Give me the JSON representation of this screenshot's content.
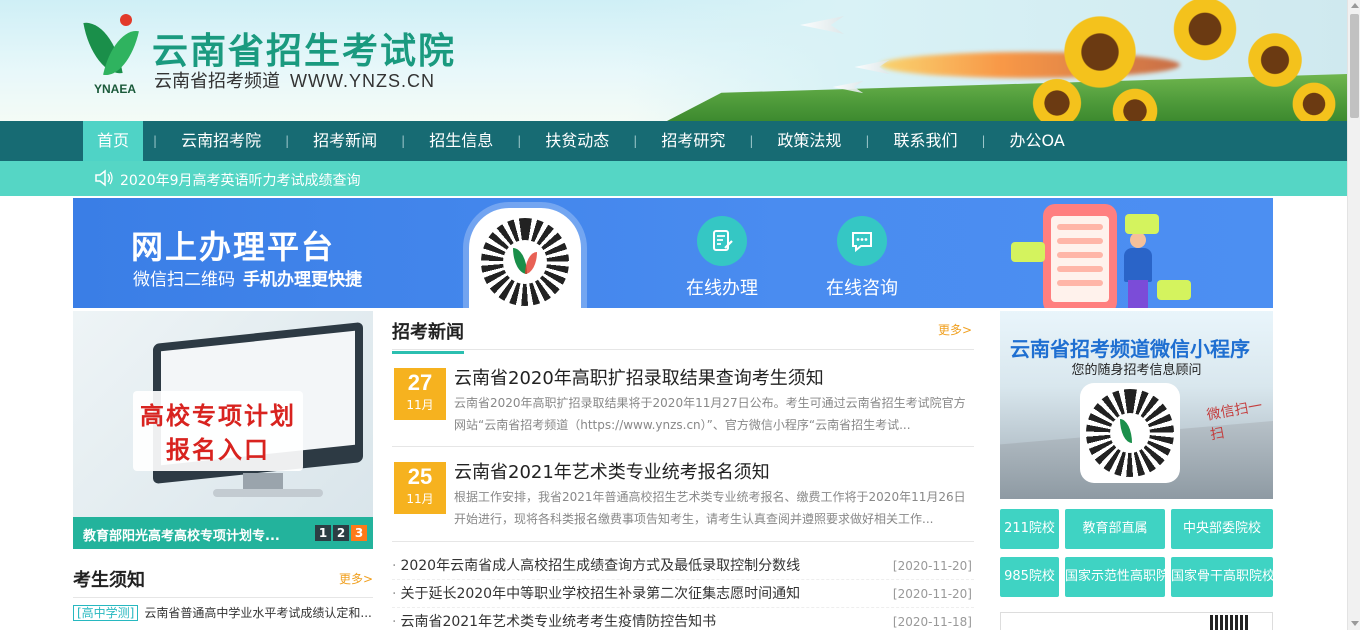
{
  "header": {
    "logo_abbr": "YNAEA",
    "title": "云南省招生考试院",
    "subtitle": "云南省招考频道",
    "url": "WWW.YNZS.CN"
  },
  "nav": {
    "items": [
      {
        "label": "首页",
        "active": true
      },
      {
        "label": "云南招考院"
      },
      {
        "label": "招考新闻"
      },
      {
        "label": "招生信息"
      },
      {
        "label": "扶贫动态"
      },
      {
        "label": "招考研究"
      },
      {
        "label": "政策法规"
      },
      {
        "label": "联系我们"
      },
      {
        "label": "办公OA"
      }
    ]
  },
  "ticker": {
    "icon": "speaker-icon",
    "text": "2020年9月高考英语听力考试成绩查询"
  },
  "platform": {
    "title": "网上办理平台",
    "subtitle_a": "微信扫二维码",
    "subtitle_b": "手机办理更快捷",
    "services": [
      {
        "label": "在线办理",
        "icon": "form-edit-icon"
      },
      {
        "label": "在线咨询",
        "icon": "chat-icon"
      }
    ]
  },
  "promo": {
    "headline_1": "高校专项计划",
    "headline_2": "报名入口",
    "caption": "教育部阳光高考高校专项计划专...",
    "pages": [
      "1",
      "2",
      "3"
    ],
    "active_page": "3"
  },
  "notice": {
    "title": "考生须知",
    "more": "更多>",
    "rows": [
      {
        "tag": "[高中学测]",
        "text": "云南省普通高中学业水平考试成绩认定和..."
      }
    ]
  },
  "news": {
    "title": "招考新闻",
    "more": "更多>",
    "featured": [
      {
        "day": "27",
        "month": "11月",
        "title": "云南省2020年高职扩招录取结果查询考生须知",
        "desc": "云南省2020年高职扩招录取结果将于2020年11月27日公布。考生可通过云南省招生考试院官方网站“云南省招考频道（https://www.ynzs.cn）”、官方微信小程序“云南省招生考试..."
      },
      {
        "day": "25",
        "month": "11月",
        "title": "云南省2021年艺术类专业统考报名须知",
        "desc": "根据工作安排，我省2021年普通高校招生艺术类专业统考报名、缴费工作将于2020年11月26日开始进行，现将各科类报名缴费事项告知考生，请考生认真查阅并遵照要求做好相关工作..."
      }
    ],
    "list": [
      {
        "bullet": "·",
        "title": "2020年云南省成人高校招生成绩查询方式及最低录取控制分数线",
        "date": "[2020-11-20]"
      },
      {
        "bullet": "·",
        "title": "关于延长2020年中等职业学校招生补录第二次征集志愿时间通知",
        "date": "[2020-11-20]"
      },
      {
        "bullet": "·",
        "title": "云南省2021年艺术类专业统考考生疫情防控告知书",
        "date": "[2020-11-18]"
      }
    ]
  },
  "mini_program": {
    "title": "云南省招考频道微信小程序",
    "subtitle": "您的随身招考信息顾问",
    "hand_text": "微信扫一扫"
  },
  "categories": [
    {
      "label": "211院校"
    },
    {
      "label": "教育部直属"
    },
    {
      "label": "中央部委院校"
    },
    {
      "label": "985院校"
    },
    {
      "label": "国家示范性高职院"
    },
    {
      "label": "国家骨干高职院校"
    }
  ],
  "colors": {
    "nav_bg": "#176b73",
    "accent_teal": "#55d6c5",
    "date_badge": "#f6b21f",
    "platform_blue": "#4a8cf0"
  }
}
